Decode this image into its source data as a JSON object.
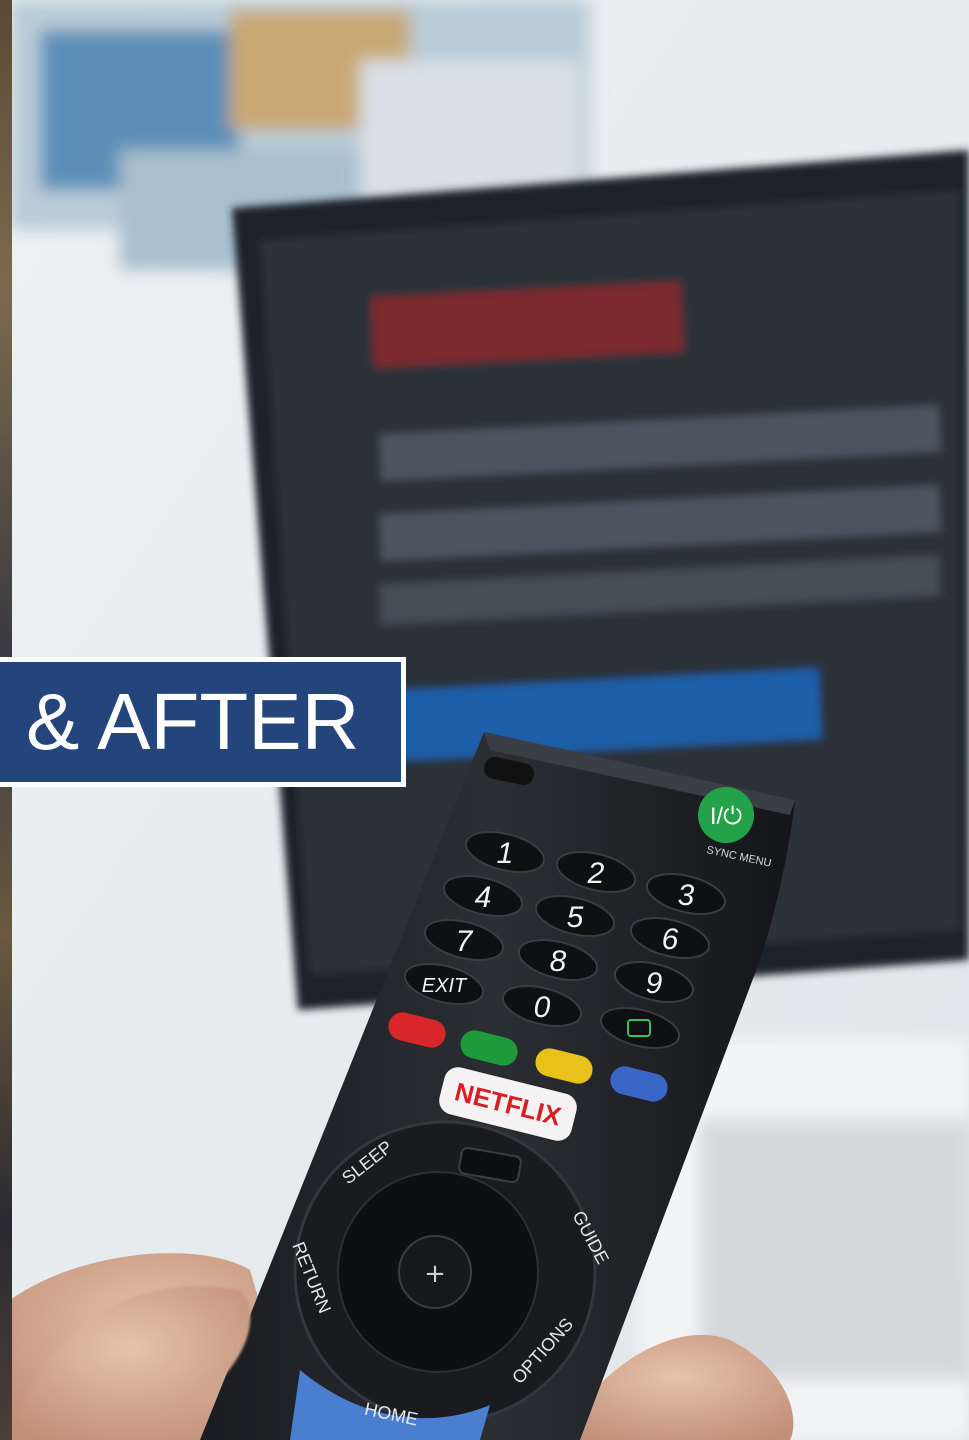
{
  "overlay": {
    "banner_text": "& AFTER",
    "background_color": "#24457c",
    "border_color": "#ffffff",
    "text_color": "#ffffff"
  },
  "photo": {
    "icon": "tv-remote-photo",
    "remote": {
      "digits": [
        "1",
        "2",
        "3",
        "4",
        "5",
        "6",
        "7",
        "8",
        "9",
        "0"
      ],
      "exit_label": "EXIT",
      "netflix_label": "NETFLIX",
      "sleep_label": "SLEEP",
      "guide_label": "GUIDE",
      "return_label": "RETURN",
      "options_label": "OPTIONS",
      "home_label": "HOME",
      "power_label": "I/⏻",
      "sync_menu_label": "SYNC MENU",
      "color_keys": [
        "#d8262a",
        "#1e9a3a",
        "#e8c21a",
        "#3a66c8"
      ]
    }
  }
}
